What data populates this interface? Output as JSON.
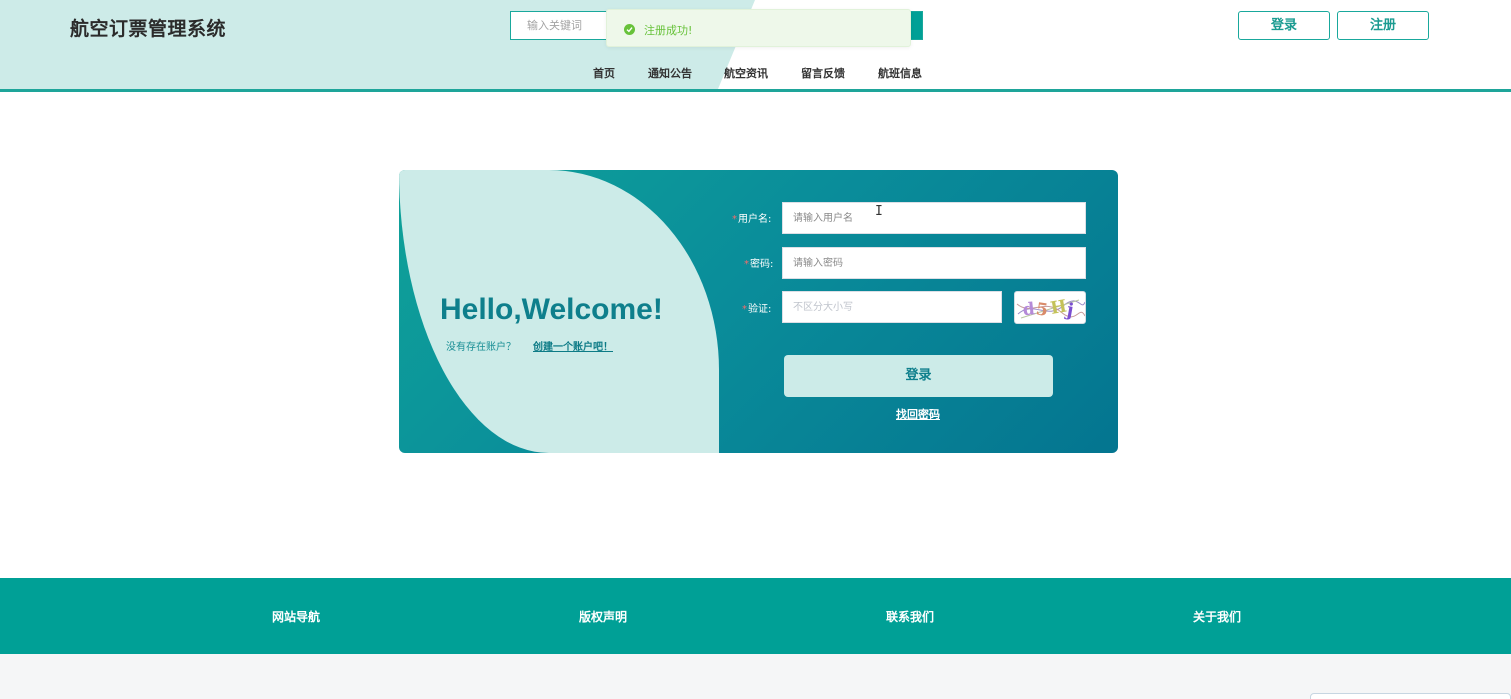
{
  "header": {
    "site_title": "航空订票管理系统",
    "search_placeholder": "输入关键词",
    "toast_message": "注册成功!",
    "login_label": "登录",
    "register_label": "注册",
    "nav": [
      "首页",
      "通知公告",
      "航空资讯",
      "留言反馈",
      "航班信息"
    ]
  },
  "login_card": {
    "welcome": "Hello,Welcome!",
    "no_account_text": "没有存在账户？",
    "create_account_link": "创建一个账户吧！",
    "username_label": "用户名:",
    "username_placeholder": "请输入用户名",
    "password_label": "密码:",
    "password_placeholder": "请输入密码",
    "captcha_label": "验证:",
    "captcha_placeholder": "不区分大小写",
    "captcha_code": "d5Hj",
    "login_button": "登录",
    "forgot_password": "找回密码"
  },
  "footer": {
    "items": [
      "网站导航",
      "版权声明",
      "联系我们",
      "关于我们"
    ]
  },
  "colors": {
    "primary": "#00a096",
    "light_mint": "#ccebe8",
    "success": "#67c23a",
    "required": "#f56c6c"
  }
}
